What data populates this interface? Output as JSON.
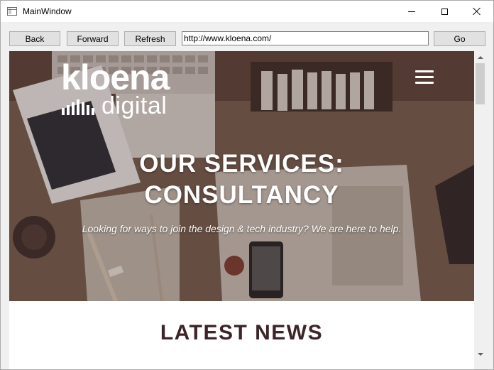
{
  "window": {
    "title": "MainWindow"
  },
  "toolbar": {
    "back_label": "Back",
    "forward_label": "Forward",
    "refresh_label": "Refresh",
    "url": "http://www.kloena.com/",
    "go_label": "Go"
  },
  "page": {
    "logo": {
      "wordmark": "kloena",
      "subword": "digital"
    },
    "hero": {
      "heading_line1": "OUR SERVICES:",
      "heading_line2": "CONSULTANCY",
      "subtitle": "Looking for ways to join the design & tech industry? We are here to help."
    },
    "news_heading": "LATEST NEWS"
  },
  "icons": {
    "app": "window-app-icon",
    "minimize": "minimize-icon",
    "maximize": "maximize-icon",
    "close": "close-icon",
    "menu": "hamburger-menu-icon"
  },
  "colors": {
    "news_heading": "#3d2428",
    "hero_text": "#ffffff",
    "hero_bg": "#6c5347"
  }
}
